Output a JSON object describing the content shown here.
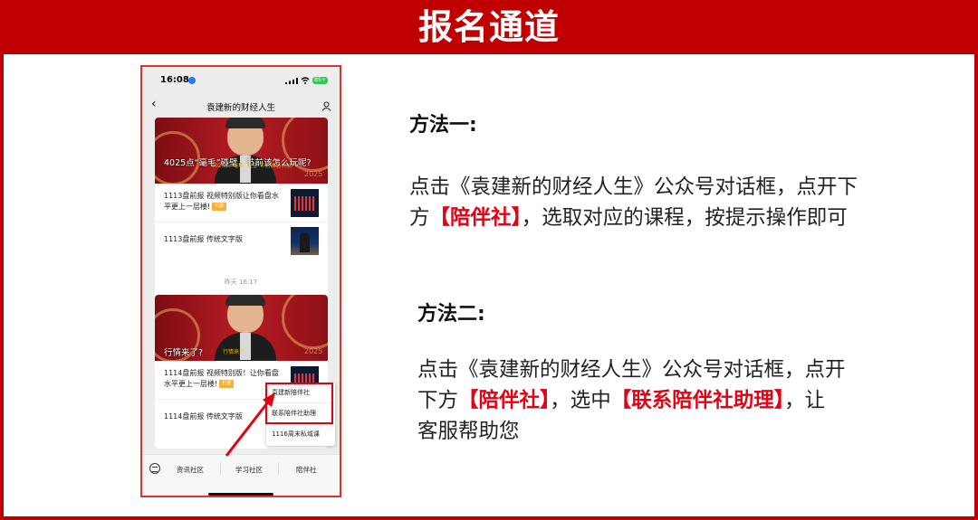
{
  "header": {
    "title": "报名通道"
  },
  "phone": {
    "status_time": "16:08",
    "battery_label": "85+",
    "nav_back": "‹",
    "nav_title": "袁建新的财经人生",
    "card1": {
      "banner_caption": "4025点“毫毛”碰壁，节前该怎么玩呢?",
      "banner_sub": "4025点“毫毛”碰壁 节前该怎么玩",
      "banner_year": "2025",
      "item1": "1113盘前报 视频特别版让你看盘水平更上一层楼!",
      "item1_tag": "付费",
      "item2": "1113盘前报 传统文字版"
    },
    "timestamp": "昨天 16:17",
    "card2": {
      "banner_caption": "行情来了?",
      "banner_sub": "行情来了",
      "banner_year": "2025",
      "item1": "1114盘前报 视频特别版！让你看盘水平更上一层楼!",
      "item1_tag": "付费",
      "item2": "1114盘前报 传统文字版"
    },
    "menu": {
      "items": [
        "袁建新陪伴社",
        "联系陪伴社助理",
        "1116周末私域课"
      ]
    },
    "bottom_bar": {
      "items": [
        "资讯社区",
        "学习社区",
        "陪伴社"
      ]
    }
  },
  "methods": {
    "one": {
      "title": "方法一:",
      "line1": "点击《袁建新的财经人生》公众号对话框，点开下",
      "line2_pre": "方",
      "line2_hl": "【陪伴社】",
      "line2_post": "，选取对应的课程，按提示操作即可"
    },
    "two": {
      "title": "方法二:",
      "line1": "点击《袁建新的财经人生》公众号对话框，点开",
      "line2_pre": "下方",
      "line2_hl1": "【陪伴社】",
      "line2_mid": "，选中",
      "line2_hl2": "【联系陪伴社助理】",
      "line2_post": "，让",
      "line3": "客服帮助您"
    }
  },
  "colors": {
    "accent": "#c00000",
    "highlight": "#e60012"
  }
}
